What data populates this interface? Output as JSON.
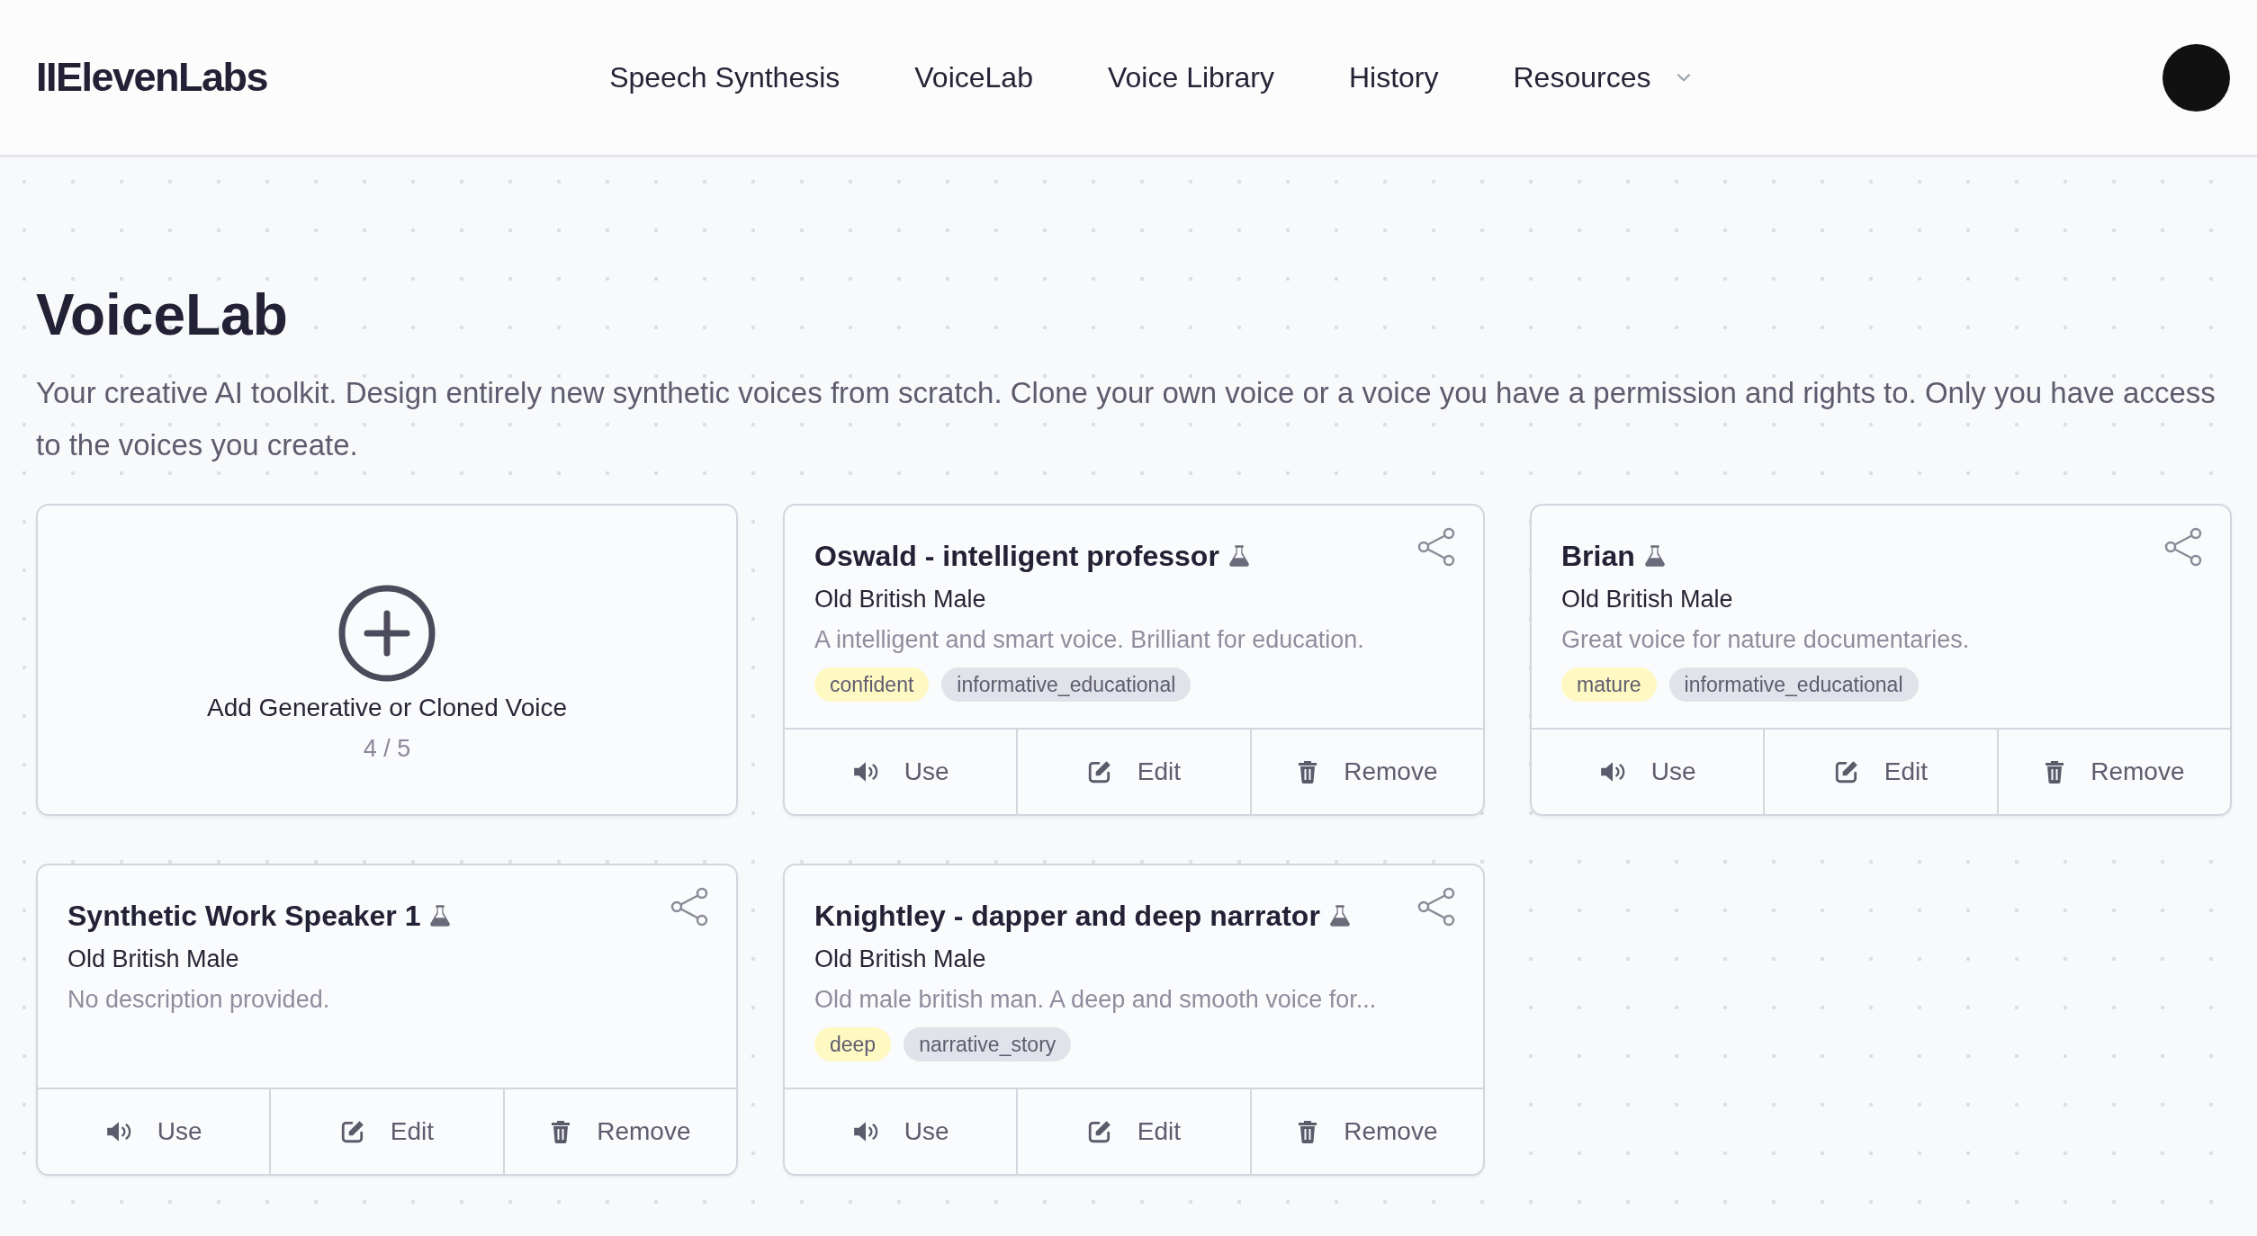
{
  "header": {
    "logo": "IIElevenLabs",
    "nav": [
      {
        "label": "Speech Synthesis",
        "has_menu": false
      },
      {
        "label": "VoiceLab",
        "has_menu": false
      },
      {
        "label": "Voice Library",
        "has_menu": false
      },
      {
        "label": "History",
        "has_menu": false
      },
      {
        "label": "Resources",
        "has_menu": true
      }
    ]
  },
  "page": {
    "title": "VoiceLab",
    "description": "Your creative AI toolkit. Design entirely new synthetic voices from scratch. Clone your own voice or a voice you have a permission and rights to. Only you have access to the voices you create."
  },
  "add_card": {
    "label": "Add Generative or Cloned Voice",
    "count": "4 / 5"
  },
  "voices": [
    {
      "name": "Oswald - intelligent professor",
      "generated": true,
      "category": "Old British Male",
      "description": "A intelligent and smart voice. Brilliant for education.",
      "tags": [
        {
          "label": "confident",
          "color": "#fef9c3"
        },
        {
          "label": "informative_educational",
          "color": "#e1e3ea"
        }
      ],
      "actions": [
        {
          "kind": "use",
          "label": "Use"
        },
        {
          "kind": "edit",
          "label": "Edit"
        },
        {
          "kind": "remove",
          "label": "Remove"
        }
      ]
    },
    {
      "name": "Brian",
      "generated": true,
      "category": "Old British Male",
      "description": "Great voice for nature documentaries.",
      "tags": [
        {
          "label": "mature",
          "color": "#fef9c3"
        },
        {
          "label": "informative_educational",
          "color": "#e1e3ea"
        }
      ],
      "actions": [
        {
          "kind": "use",
          "label": "Use"
        },
        {
          "kind": "edit",
          "label": "Edit"
        },
        {
          "kind": "remove",
          "label": "Remove"
        }
      ]
    },
    {
      "name": "Synthetic Work Speaker 1",
      "generated": true,
      "category": "Old British Male",
      "description": "No description provided.",
      "actions": [
        {
          "kind": "use",
          "label": "Use"
        },
        {
          "kind": "edit",
          "label": "Edit"
        },
        {
          "kind": "remove",
          "label": "Remove"
        }
      ]
    },
    {
      "name": "Knightley - dapper and deep narrator",
      "generated": true,
      "category": "Old British Male",
      "description": "Old male british man. A deep and smooth voice for...",
      "tags": [
        {
          "label": "deep",
          "color": "#fef9c3"
        },
        {
          "label": "narrative_story",
          "color": "#e1e3ea"
        }
      ],
      "actions": [
        {
          "kind": "use",
          "label": "Use"
        },
        {
          "kind": "edit",
          "label": "Edit"
        },
        {
          "kind": "remove",
          "label": "Remove"
        }
      ]
    }
  ]
}
